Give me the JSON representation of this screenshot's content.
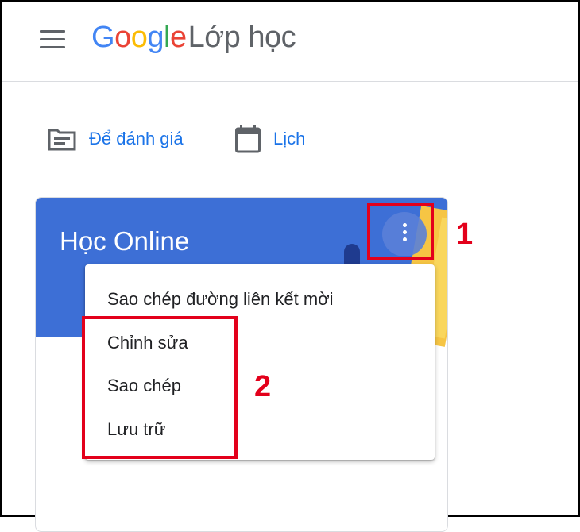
{
  "header": {
    "brand_letters": [
      {
        "ch": "G",
        "color": "#4285F4"
      },
      {
        "ch": "o",
        "color": "#EA4335"
      },
      {
        "ch": "o",
        "color": "#FBBC05"
      },
      {
        "ch": "g",
        "color": "#4285F4"
      },
      {
        "ch": "l",
        "color": "#34A853"
      },
      {
        "ch": "e",
        "color": "#EA4335"
      }
    ],
    "product": "Lớp học"
  },
  "nav": {
    "todo_label": "Để đánh giá",
    "calendar_label": "Lịch"
  },
  "card": {
    "title": "Học Online",
    "menu_items": [
      "Sao chép đường liên kết mời",
      "Chỉnh sửa",
      "Sao chép",
      "Lưu trữ"
    ]
  },
  "annotations": {
    "label_1": "1",
    "label_2": "2",
    "highlight_color": "#E3001B"
  },
  "colors": {
    "link_blue": "#1A73E8",
    "card_header": "#3D6FD6"
  }
}
